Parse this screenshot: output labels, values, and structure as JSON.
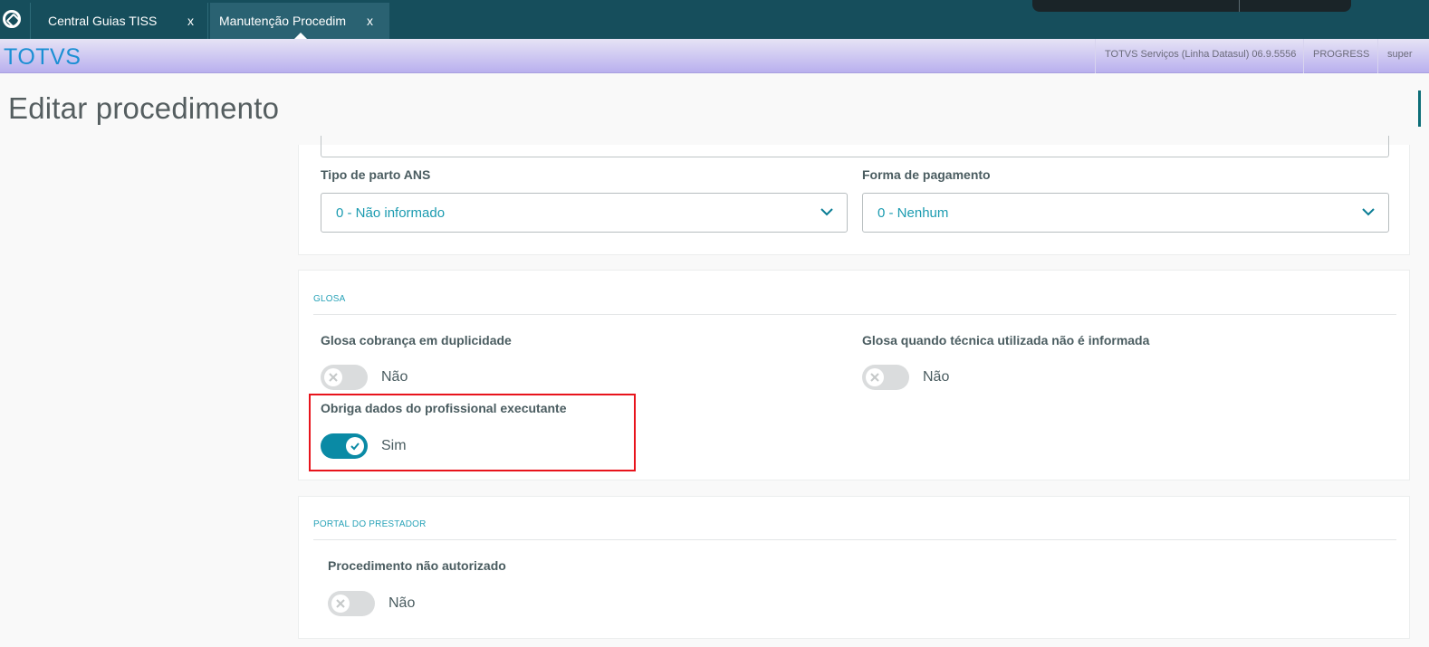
{
  "tabs": [
    {
      "label": "Central Guias TISS",
      "close": "x"
    },
    {
      "label": "Manutenção Procedim",
      "close": "x"
    }
  ],
  "header": {
    "brand": "TOTVS",
    "system": "TOTVS Serviços (Linha Datasul) 06.9.5556",
    "database": "PROGRESS",
    "user": "super"
  },
  "page": {
    "title": "Editar procedimento"
  },
  "fields": {
    "tipo_parto": {
      "label": "Tipo de parto ANS",
      "value": "0 - Não informado"
    },
    "forma_pagamento": {
      "label": "Forma de pagamento",
      "value": "0 - Nenhum"
    }
  },
  "glosa": {
    "section_title": "GLOSA",
    "duplicidade": {
      "label": "Glosa cobrança em duplicidade",
      "state": "Não"
    },
    "tecnica": {
      "label": "Glosa quando técnica utilizada não é informada",
      "state": "Não"
    },
    "obriga_dados": {
      "label": "Obriga dados do profissional executante",
      "state": "Sim"
    }
  },
  "portal": {
    "section_title": "PORTAL DO PRESTADOR",
    "nao_autorizado": {
      "label": "Procedimento não autorizado",
      "state": "Não"
    }
  },
  "colors": {
    "tabbar": "#164e5c",
    "accent": "#0a8aa5",
    "section_title": "#29a3b8",
    "highlight": "#e8141c"
  }
}
